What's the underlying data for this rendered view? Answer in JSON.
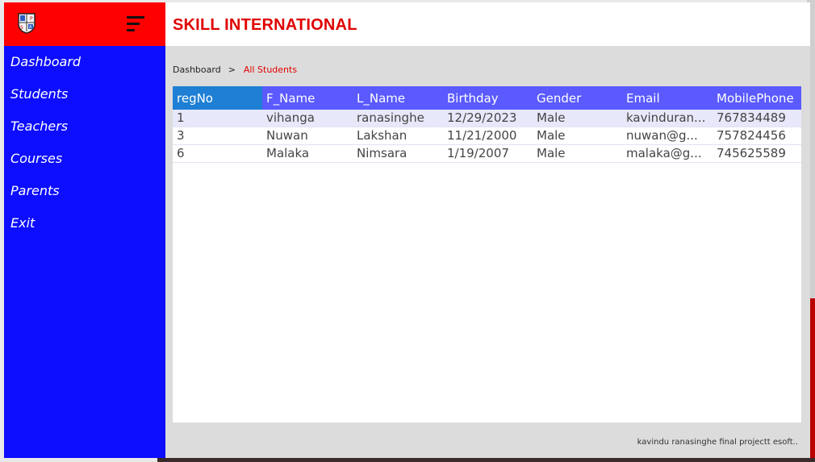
{
  "app": {
    "title": "SKILL INTERNATIONAL",
    "logo_letters": [
      "P",
      "S",
      "A"
    ]
  },
  "sidebar": {
    "items": [
      {
        "label": "Dashboard"
      },
      {
        "label": "Students"
      },
      {
        "label": "Teachers"
      },
      {
        "label": "Courses"
      },
      {
        "label": "Parents"
      },
      {
        "label": "Exit"
      }
    ]
  },
  "breadcrumb": {
    "root": "Dashboard",
    "separator": ">",
    "current": "All Students"
  },
  "table": {
    "columns": [
      "regNo",
      "F_Name",
      "L_Name",
      "Birthday",
      "Gender",
      "Email",
      "MobilePhone"
    ],
    "rows": [
      [
        "1",
        "vihanga",
        "ranasinghe",
        "12/29/2023",
        "Male",
        "kavinduran...",
        "767834489"
      ],
      [
        "3",
        "Nuwan",
        "Lakshan",
        "11/21/2000",
        "Male",
        "nuwan@g...",
        "757824456"
      ],
      [
        "6",
        "Malaka",
        "Nimsara",
        "1/19/2007",
        "Male",
        "malaka@g...",
        "745625589"
      ]
    ],
    "selected_row": 0
  },
  "footer": {
    "text": "kavindu ranasinghe final projectt esoft.."
  },
  "colors": {
    "sidebar": "#0d0dff",
    "logo_bar": "#ff0000",
    "accent": "#e00000",
    "grid_header": "#5a5aff",
    "grid_header_first": "#1e7fd4"
  }
}
